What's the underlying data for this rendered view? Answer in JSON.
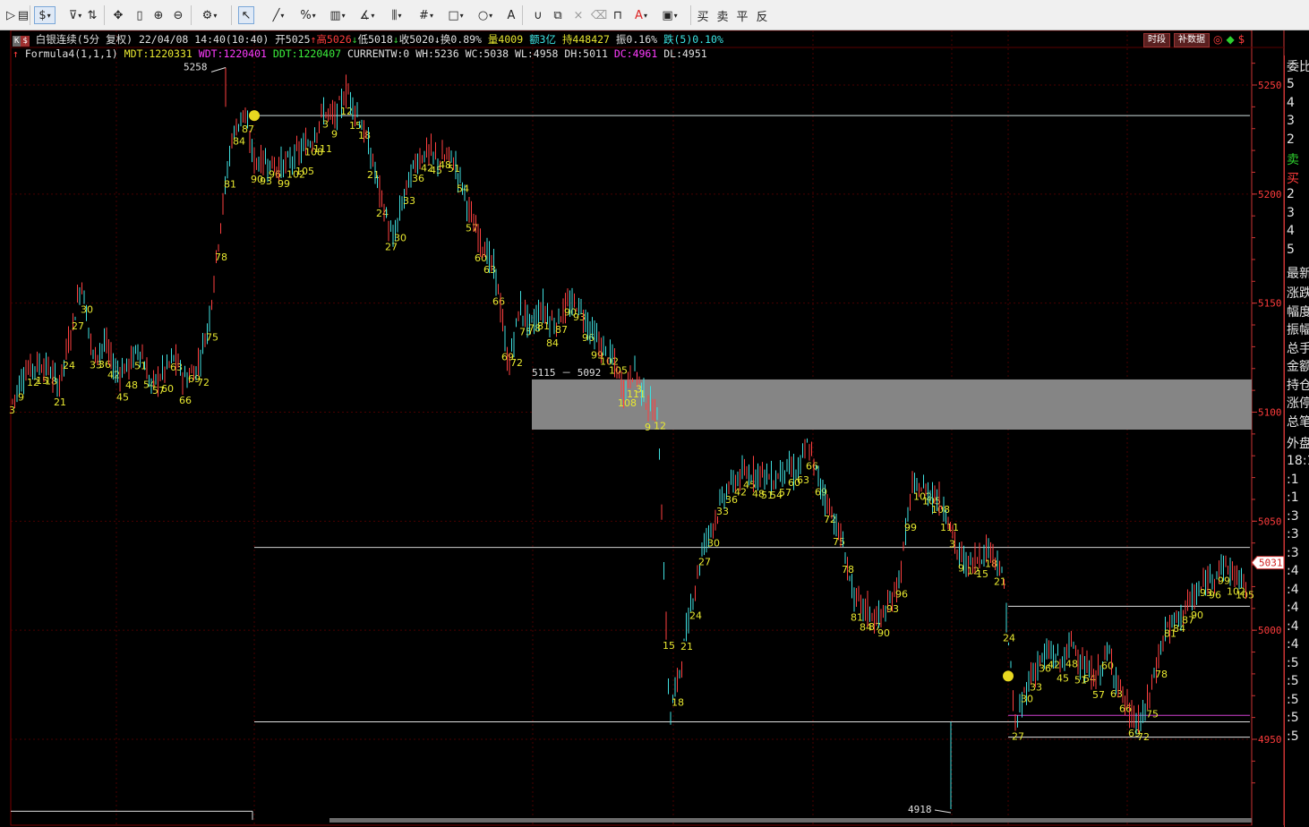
{
  "toolbar": {
    "tools": [
      {
        "name": "play-icon",
        "glyph": "▷"
      },
      {
        "name": "document-icon",
        "glyph": "▤"
      },
      {
        "name": "dollar-icon",
        "glyph": "$"
      },
      {
        "name": "filter-icon",
        "glyph": "⊽"
      },
      {
        "name": "sort-icon",
        "glyph": "⇅"
      },
      {
        "name": "move-icon",
        "glyph": "✥"
      },
      {
        "name": "column-icon",
        "glyph": "▯"
      },
      {
        "name": "zoom-in-icon",
        "glyph": "⊕"
      },
      {
        "name": "zoom-out-icon",
        "glyph": "⊖"
      },
      {
        "name": "settings-icon",
        "glyph": "⚙"
      },
      {
        "name": "pointer-icon",
        "glyph": "↖"
      },
      {
        "name": "line-icon",
        "glyph": "╱"
      },
      {
        "name": "percent-icon",
        "glyph": "%"
      },
      {
        "name": "ruler-icon",
        "glyph": "▥"
      },
      {
        "name": "angle-icon",
        "glyph": "∡"
      },
      {
        "name": "channel-icon",
        "glyph": "⫼"
      },
      {
        "name": "grid-icon",
        "glyph": "#"
      },
      {
        "name": "rect-icon",
        "glyph": "□"
      },
      {
        "name": "circle-icon",
        "glyph": "○"
      },
      {
        "name": "text-icon",
        "glyph": "A"
      },
      {
        "name": "magnet-icon",
        "glyph": "∪"
      },
      {
        "name": "copy-icon",
        "glyph": "⧉"
      },
      {
        "name": "close-icon",
        "glyph": "×"
      },
      {
        "name": "trash-icon",
        "glyph": "⌫"
      },
      {
        "name": "lock-icon",
        "glyph": "⊓"
      },
      {
        "name": "color-icon",
        "glyph": "A"
      },
      {
        "name": "save-icon",
        "glyph": "▣"
      }
    ],
    "trade": [
      "买",
      "卖",
      "平",
      "反"
    ]
  },
  "header": {
    "chips": [
      "K",
      "$"
    ],
    "name": "白银连续(5分",
    "fq": "复权)",
    "datetime": "22/04/08 14:40(10:40)",
    "open": "开5025",
    "high": "高5026",
    "low": "低5018",
    "close": "收5020",
    "turnover": "换0.89%",
    "volume": "量4009",
    "amount": "额3亿",
    "position": "持448427",
    "amplitude": "振0.16%",
    "change": "跌(5)0.10%",
    "btn_period": "时段",
    "btn_fill": "补数据"
  },
  "indicator": {
    "name": "Formula4(1,1,1)",
    "mdt": "MDT:1220331",
    "wdt": "WDT:1220401",
    "ddt": "DDT:1220407",
    "currentw": "CURRENTW:0",
    "wh": "WH:5236",
    "wc": "WC:5038",
    "wl": "WL:4958",
    "dh": "DH:5011",
    "dc": "DC:4961",
    "dl": "DL:4951"
  },
  "yaxis": {
    "ticks": [
      "5250",
      "5200",
      "5150",
      "5100",
      "5050",
      "5000",
      "4950"
    ],
    "last_price": "5031"
  },
  "annotations": {
    "high_label": "5258",
    "low_label": "4918",
    "zone_label": "5115 － 5092"
  },
  "right_panel": {
    "items": [
      "委比",
      "5",
      "4",
      "3",
      "2",
      "卖",
      "买",
      "2",
      "3",
      "4",
      "5",
      "最新",
      "涨跌",
      "幅度",
      "振幅",
      "总手",
      "金额",
      "持仓",
      "涨停",
      "总笔",
      "外盘",
      "18:1",
      ":1",
      ":1",
      ":3",
      ":3",
      ":3",
      ":4",
      ":4",
      ":4",
      ":4",
      ":4",
      ":5",
      ":5",
      ":5",
      ":5",
      ":5"
    ]
  },
  "chart_data": {
    "type": "candlestick",
    "ylim": [
      4916,
      5262
    ],
    "ohlc_anchors": [
      5105,
      5118,
      5122,
      5121,
      5112,
      5135,
      5160,
      5125,
      5132,
      5118,
      5121,
      5130,
      5112,
      5118,
      5125,
      5115,
      5120,
      5140,
      5185,
      5225,
      5238,
      5215,
      5215,
      5212,
      5215,
      5220,
      5225,
      5238,
      5235,
      5248,
      5236,
      5220,
      5198,
      5178,
      5200,
      5215,
      5220,
      5215,
      5218,
      5205,
      5185,
      5175,
      5162,
      5120,
      5148,
      5140,
      5148,
      5140,
      5148,
      5150,
      5140,
      5130,
      5125,
      5110,
      5120,
      5105,
      5098,
      4960,
      4985,
      5015,
      5040,
      5052,
      5065,
      5070,
      5072,
      5073,
      5068,
      5075,
      5072,
      5085,
      5068,
      5055,
      5040,
      5015,
      5010,
      5005,
      5010,
      5025,
      5065,
      5065,
      5062,
      5055,
      5035,
      5030,
      5035,
      5038,
      5022,
      4955,
      4975,
      4985,
      4990,
      4985,
      4995,
      4982,
      4978,
      4990,
      4975,
      4960,
      4958,
      4978,
      5000,
      5005,
      5012,
      5018,
      5025,
      5030,
      5026,
      5020
    ]
  }
}
